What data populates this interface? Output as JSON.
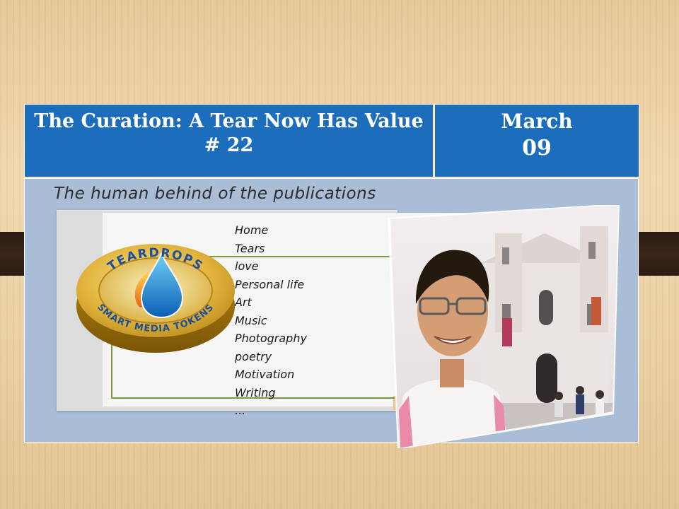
{
  "header": {
    "title_line1": "The Curation: A Tear Now Has Value",
    "title_line2": "# 22",
    "date_month": "March",
    "date_day": "09"
  },
  "subtitle": "The human behind of the publications",
  "website": {
    "logo_text_top": "TEARDROPS",
    "logo_text_bottom": "SMART MEDIA TOKENS",
    "menu": [
      "Home",
      "Tears",
      "love",
      "Personal life",
      "Art",
      "Music",
      "Photography",
      "poetry",
      "Motivation",
      "Writing",
      "..."
    ]
  },
  "colors": {
    "header_blue": "#1c6ebd",
    "panel_blue": "#a9bdd6",
    "accent_green": "#7a9a3c",
    "coin_gold": "#d6a62a"
  }
}
